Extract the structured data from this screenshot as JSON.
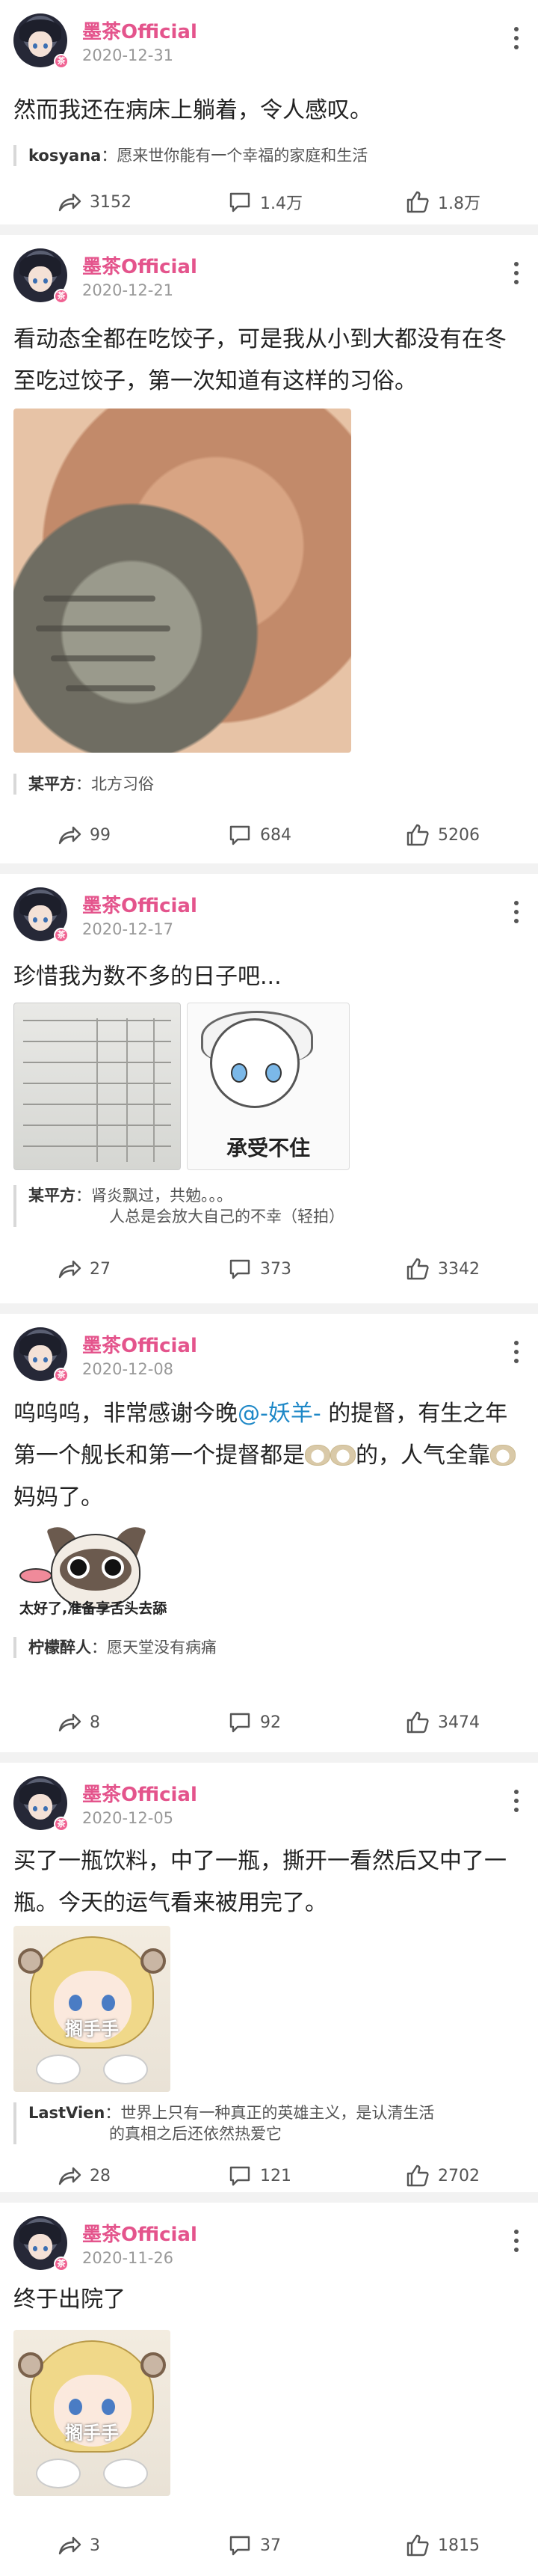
{
  "user": {
    "name": "墨茶Official",
    "badge": "茶"
  },
  "posts": [
    {
      "date": "2020-12-31",
      "text": "然而我还在病床上躺着，令人感叹。",
      "comment": {
        "author": "kosyana",
        "text": "愿来世你能有一个幸福的家庭和生活"
      },
      "stats": {
        "share": "3152",
        "comment": "1.4万",
        "like": "1.8万"
      }
    },
    {
      "date": "2020-12-21",
      "text": "看动态全都在吃饺子，可是我从小到大都没有在冬至吃过饺子，第一次知道有这样的习俗。",
      "comment": {
        "author": "某平方",
        "text": "北方习俗"
      },
      "stats": {
        "share": "99",
        "comment": "684",
        "like": "5206"
      }
    },
    {
      "date": "2020-12-17",
      "text": "珍惜我为数不多的日子吧...",
      "image_caption": "承受不住",
      "comment": {
        "author": "某平方",
        "text": "肾炎飘过，共勉。。。",
        "text2": "人总是会放大自己的不幸（轻拍）"
      },
      "stats": {
        "share": "27",
        "comment": "373",
        "like": "3342"
      }
    },
    {
      "date": "2020-12-08",
      "text_parts": [
        "呜呜呜，非常感谢今晚",
        "@-妖羊-",
        " 的提督，有生之年第一个舰长和第一个提督都是",
        "的，人气全靠",
        "妈妈了。"
      ],
      "image_caption": "太好了,准备享舌头去舔",
      "comment": {
        "author": "柠檬醉人",
        "text": "愿天堂没有病痛"
      },
      "stats": {
        "share": "8",
        "comment": "92",
        "like": "3474"
      }
    },
    {
      "date": "2020-12-05",
      "text": "买了一瓶饮料，中了一瓶，撕开一看然后又中了一瓶。今天的运气看来被用完了。",
      "image_caption": "搁手手",
      "comment": {
        "author": "LastVien",
        "text": "世界上只有一种真正的英雄主义，是认清生活",
        "text2": "的真相之后还依然热爱它"
      },
      "stats": {
        "share": "28",
        "comment": "121",
        "like": "2702"
      }
    },
    {
      "date": "2020-11-26",
      "text": "终于出院了",
      "image_caption": "搁手手",
      "stats": {
        "share": "3",
        "comment": "37",
        "like": "1815"
      }
    }
  ],
  "icons": {
    "share": "share-arrow-icon",
    "comment": "comment-bubble-icon",
    "like": "thumbs-up-icon",
    "more": "more-vertical-icon"
  },
  "colors": {
    "username": "#e4548c",
    "link": "#1e88c7",
    "separator": "#f2f2f2"
  }
}
